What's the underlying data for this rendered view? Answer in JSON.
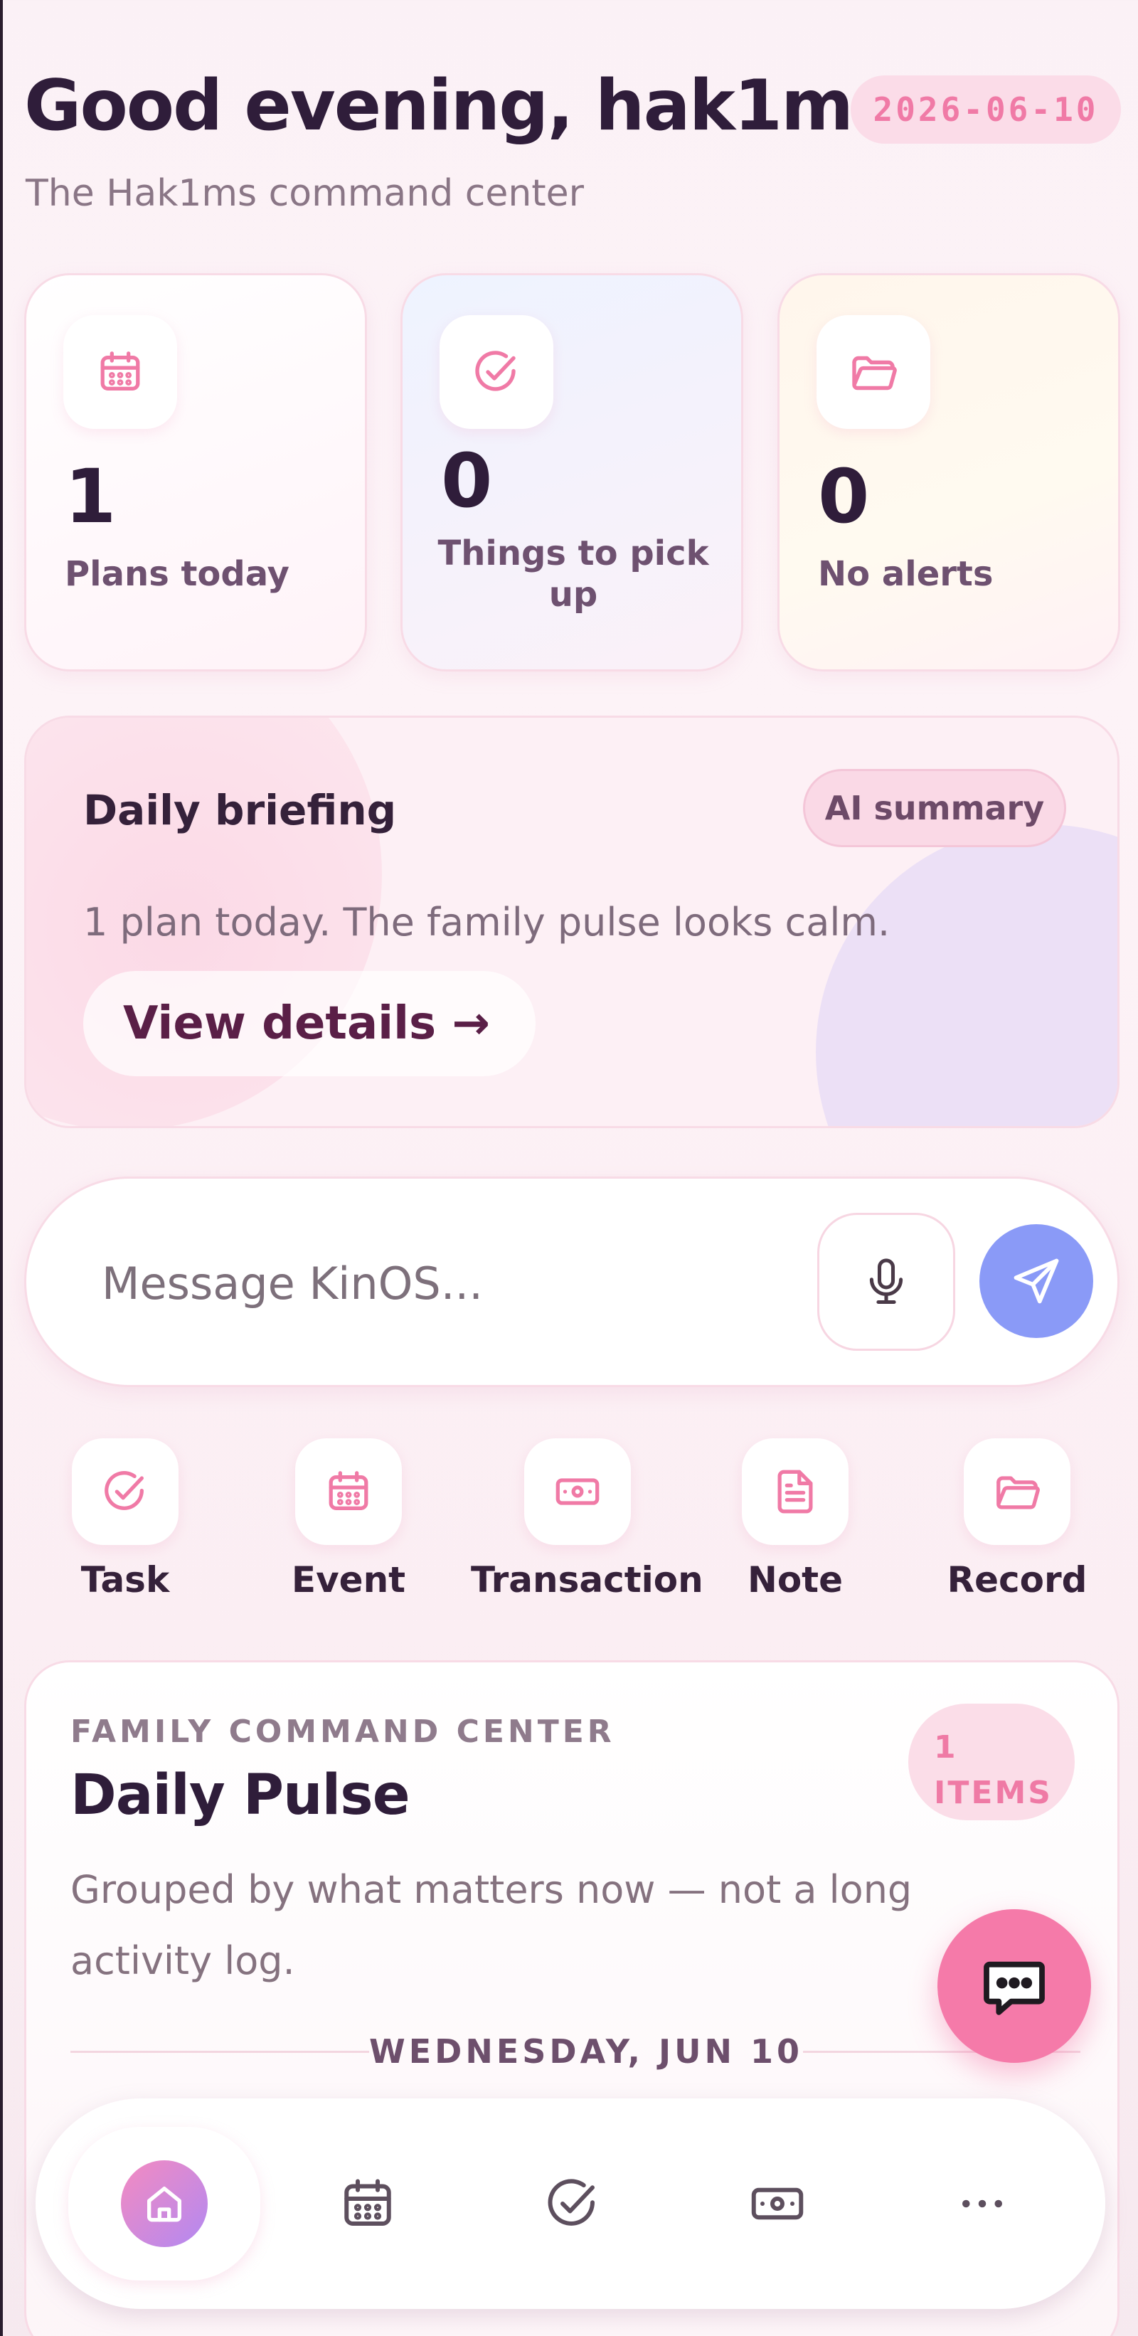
{
  "header": {
    "greeting": "Good evening, hak1m",
    "subtitle": "The Hak1ms command center",
    "date": "2026-06-10"
  },
  "stats": [
    {
      "icon": "calendar-icon",
      "value": "1",
      "label": "Plans today"
    },
    {
      "icon": "check-circle-icon",
      "value": "0",
      "label": "Things to pick up"
    },
    {
      "icon": "folder-icon",
      "value": "0",
      "label": "No alerts"
    }
  ],
  "briefing": {
    "title": "Daily briefing",
    "badge": "AI summary",
    "text": "1 plan today. The family pulse looks calm.",
    "link": "View details →"
  },
  "composer": {
    "placeholder": "Message KinOS...",
    "mic_icon": "microphone-icon",
    "send_icon": "send-icon"
  },
  "quick_actions": [
    {
      "icon": "check-circle-icon",
      "label": "Task"
    },
    {
      "icon": "calendar-icon",
      "label": "Event"
    },
    {
      "icon": "money-icon",
      "label": "Transaction"
    },
    {
      "icon": "document-icon",
      "label": "Note"
    },
    {
      "icon": "folder-icon",
      "label": "Record"
    }
  ],
  "pulse": {
    "overline": "FAMILY COMMAND CENTER",
    "title": "Daily Pulse",
    "description": "Grouped by what matters now — not a long activity log.",
    "badge_count": "1",
    "badge_unit": "ITEMS",
    "day": "WEDNESDAY, JUN 10"
  },
  "nav": {
    "items": [
      "home-icon",
      "calendar-icon",
      "check-circle-icon",
      "money-icon",
      "more-icon"
    ],
    "active": "home"
  },
  "colors": {
    "accent_pink": "#f57aa9",
    "send_blue": "#8a9af7",
    "title_dark": "#2f1d3a"
  }
}
